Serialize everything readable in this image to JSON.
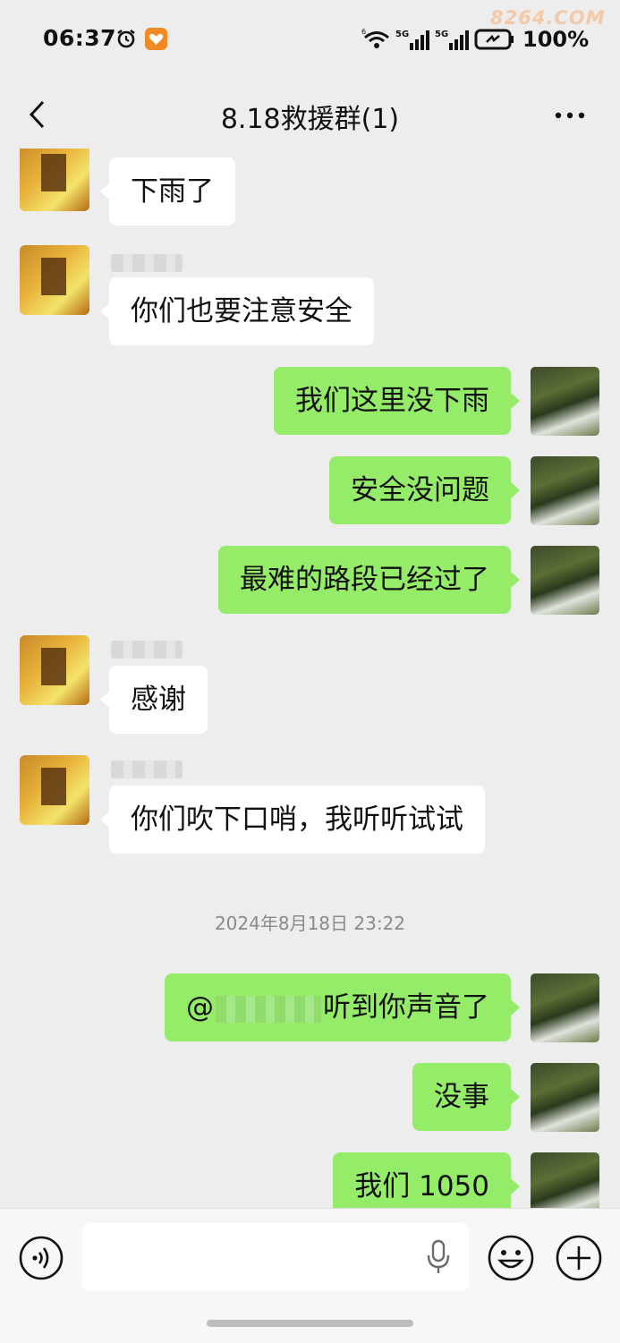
{
  "status_bar": {
    "time": "06:37",
    "battery": "100%",
    "net1": "5G",
    "net2": "5G",
    "watermark": "8264.COM"
  },
  "nav": {
    "title": "8.18救援群(1)",
    "back_icon": "chevron-left-icon",
    "more_icon": "more-dots-icon"
  },
  "messages": [
    {
      "side": "left",
      "text": "下雨了"
    },
    {
      "side": "left",
      "text": "你们也要注意安全"
    },
    {
      "side": "right",
      "text": "我们这里没下雨"
    },
    {
      "side": "right",
      "text": "安全没问题"
    },
    {
      "side": "right",
      "text": "最难的路段已经过了"
    },
    {
      "side": "left",
      "text": "感谢"
    },
    {
      "side": "left",
      "text": "你们吹下口哨，我听听试试"
    },
    {
      "side": "time",
      "text": "2024年8月18日 23:22"
    },
    {
      "side": "right",
      "prefix": "@",
      "text": "听到你声音了"
    },
    {
      "side": "right",
      "text": "没事"
    },
    {
      "side": "right",
      "text": "我们 1050"
    }
  ],
  "input_bar": {
    "placeholder": "",
    "voice_icon": "voice-input-icon",
    "mic_icon": "microphone-icon",
    "emoji_icon": "emoji-icon",
    "plus_icon": "plus-icon"
  },
  "colors": {
    "background": "#ededed",
    "self_bubble": "#95ec69",
    "other_bubble": "#ffffff"
  }
}
